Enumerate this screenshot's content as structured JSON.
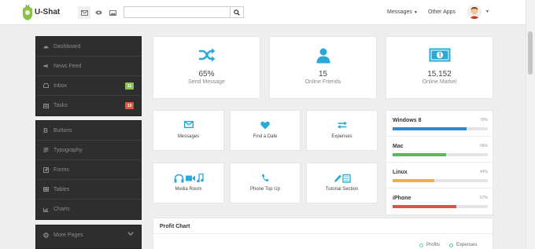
{
  "header": {
    "brand": "U-Shat",
    "search": {
      "value": "",
      "placeholder": ""
    },
    "nav": {
      "messages": "Messages",
      "other_apps": "Other Apps"
    }
  },
  "sidebar": {
    "group1": [
      {
        "label": "Dashboard",
        "icon": "dashboard-icon"
      },
      {
        "label": "News Feed",
        "icon": "news-feed-icon"
      },
      {
        "label": "Inbox",
        "icon": "inbox-icon",
        "badge": "11",
        "badge_color": "#8bc34a"
      },
      {
        "label": "Tasks",
        "icon": "tasks-icon",
        "badge": "19",
        "badge_color": "#e5533d"
      }
    ],
    "group2": [
      {
        "label": "Buttons",
        "icon": "bold-icon"
      },
      {
        "label": "Typography",
        "icon": "typography-icon"
      },
      {
        "label": "Forms",
        "icon": "forms-icon"
      },
      {
        "label": "Tables",
        "icon": "tables-icon"
      },
      {
        "label": "Charts",
        "icon": "charts-icon"
      }
    ],
    "group3": [
      {
        "label": "More Pages",
        "icon": "more-pages-icon"
      }
    ]
  },
  "stats": [
    {
      "value": "65%",
      "label": "Send Message",
      "icon": "shuffle-icon"
    },
    {
      "value": "15",
      "label": "Online Friends",
      "icon": "user-icon"
    },
    {
      "value": "15,152",
      "label": "Online Market",
      "icon": "money-icon"
    }
  ],
  "tiles": [
    {
      "label": "Messages",
      "icon": "envelope-icon"
    },
    {
      "label": "Find a Date",
      "icon": "heart-icon"
    },
    {
      "label": "Expenses",
      "icon": "exchange-icon"
    },
    {
      "label": "Media Room",
      "icon": "media-icon"
    },
    {
      "label": "Phone Top Up",
      "icon": "phone-icon"
    },
    {
      "label": "Tutorial Section",
      "icon": "tutorial-icon"
    }
  ],
  "progress": [
    {
      "name": "Windows 8",
      "value": 78,
      "pct": "78%",
      "color": "#2d8ad0"
    },
    {
      "name": "Mac",
      "value": 56,
      "pct": "56%",
      "color": "#5cb85c"
    },
    {
      "name": "Linux",
      "value": 44,
      "pct": "44%",
      "color": "#f0ad4e"
    },
    {
      "name": "iPhone",
      "value": 67,
      "pct": "67%",
      "color": "#d9534f"
    }
  ],
  "profit_chart": {
    "title": "Profit Chart",
    "legend": [
      {
        "label": "Profits",
        "color": "#57d3c8"
      },
      {
        "label": "Expenses",
        "color": "#57c089"
      }
    ]
  },
  "colors": {
    "accent": "#29a9d8",
    "sidebar_bg": "#2e2e2e"
  }
}
